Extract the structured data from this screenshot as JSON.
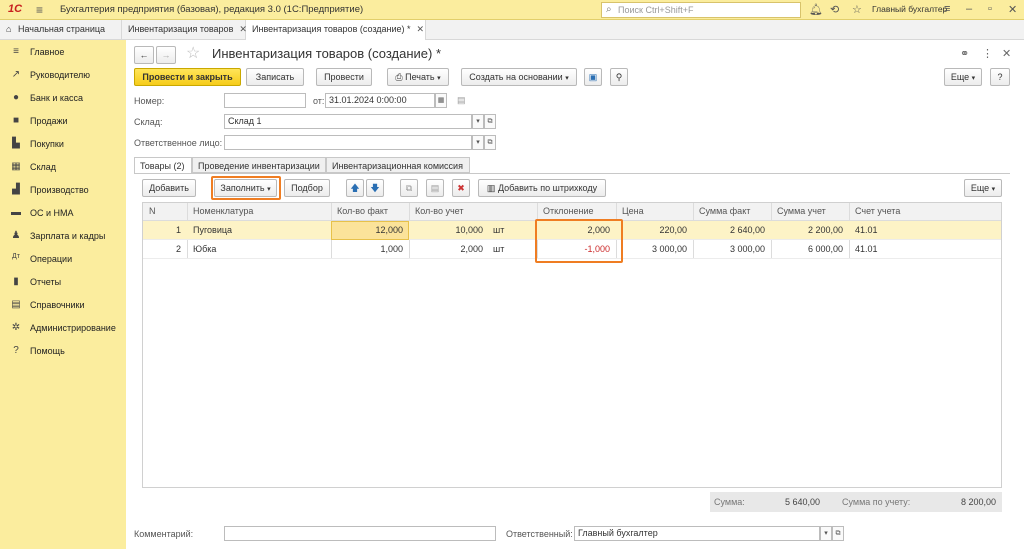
{
  "titlebar": {
    "logo": "1С",
    "title": "Бухгалтерия предприятия (базовая), редакция 3.0  (1С:Предприятие)",
    "search_placeholder": "Поиск Ctrl+Shift+F",
    "user": "Главный бухгалтер"
  },
  "tabs": [
    {
      "label": "Начальная страница"
    },
    {
      "label": "Инвентаризация товаров"
    },
    {
      "label": "Инвентаризация товаров (создание) *"
    }
  ],
  "sidebar": {
    "items": [
      {
        "label": "Главное",
        "icon": "menu-icon"
      },
      {
        "label": "Руководителю",
        "icon": "chart-line-icon"
      },
      {
        "label": "Банк и касса",
        "icon": "coins-icon"
      },
      {
        "label": "Продажи",
        "icon": "bag-icon"
      },
      {
        "label": "Покупки",
        "icon": "cart-icon"
      },
      {
        "label": "Склад",
        "icon": "warehouse-icon"
      },
      {
        "label": "Производство",
        "icon": "factory-icon"
      },
      {
        "label": "ОС и НМА",
        "icon": "truck-icon"
      },
      {
        "label": "Зарплата и кадры",
        "icon": "person-icon"
      },
      {
        "label": "Операции",
        "icon": "operations-icon"
      },
      {
        "label": "Отчеты",
        "icon": "bar-chart-icon"
      },
      {
        "label": "Справочники",
        "icon": "books-icon"
      },
      {
        "label": "Администрирование",
        "icon": "gear-icon"
      },
      {
        "label": "Помощь",
        "icon": "question-icon"
      }
    ]
  },
  "form": {
    "title": "Инвентаризация товаров (создание) *",
    "toolbar": {
      "post_close": "Провести и закрыть",
      "save": "Записать",
      "post": "Провести",
      "print": "Печать",
      "create_based": "Создать на основании",
      "more": "Еще",
      "help": "?"
    },
    "number_label": "Номер:",
    "number_value": "",
    "date_label": "от:",
    "date_value": "31.01.2024  0:00:00",
    "warehouse_label": "Склад:",
    "warehouse_value": "Склад 1",
    "responsible_label": "Ответственное лицо:",
    "responsible_value": "",
    "inner_tabs": [
      "Товары (2)",
      "Проведение инвентаризации",
      "Инвентаризационная комиссия"
    ],
    "table_toolbar": {
      "add": "Добавить",
      "fill": "Заполнить",
      "select": "Подбор",
      "add_barcode": "Добавить по штрихкоду",
      "more": "Еще"
    },
    "columns": [
      "N",
      "Номенклатура",
      "Кол-во факт",
      "Кол-во учет",
      "Отклонение",
      "Цена",
      "Сумма факт",
      "Сумма учет",
      "Счет учета"
    ],
    "rows": [
      {
        "n": "1",
        "name": "Пуговица",
        "qty_fact": "12,000",
        "qty_book": "10,000",
        "unit": "шт",
        "deviation": "2,000",
        "price": "220,00",
        "sum_fact": "2 640,00",
        "sum_book": "2 200,00",
        "account": "41.01"
      },
      {
        "n": "2",
        "name": "Юбка",
        "qty_fact": "1,000",
        "qty_book": "2,000",
        "unit": "шт",
        "deviation": "-1,000",
        "price": "3 000,00",
        "sum_fact": "3 000,00",
        "sum_book": "6 000,00",
        "account": "41.01"
      }
    ],
    "footer": {
      "sum_label": "Сумма:",
      "sum_value": "5 640,00",
      "sum_book_label": "Сумма по учету:",
      "sum_book_value": "8 200,00"
    },
    "comment_label": "Комментарий:",
    "comment_value": "",
    "responsible2_label": "Ответственный:",
    "responsible2_value": "Главный бухгалтер"
  },
  "colors": {
    "accent_yellow": "#fbed9e",
    "highlight_orange": "#ef7d22",
    "negative_red": "#cc2b2b",
    "selected_row": "#fdf3c6"
  }
}
